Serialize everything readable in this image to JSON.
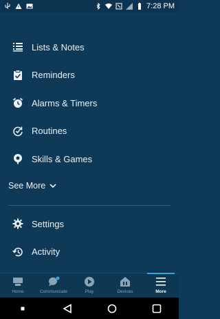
{
  "status": {
    "time": "7:28 PM"
  },
  "menu": {
    "items": [
      {
        "label": "Lists & Notes",
        "icon": "list-icon"
      },
      {
        "label": "Reminders",
        "icon": "reminder-icon"
      },
      {
        "label": "Alarms & Timers",
        "icon": "alarm-icon"
      },
      {
        "label": "Routines",
        "icon": "routine-icon"
      },
      {
        "label": "Skills & Games",
        "icon": "skills-icon"
      }
    ],
    "see_more": "See More",
    "secondary": [
      {
        "label": "Settings",
        "icon": "gear-icon"
      },
      {
        "label": "Activity",
        "icon": "history-icon"
      }
    ]
  },
  "nav": {
    "tabs": [
      {
        "label": "Home"
      },
      {
        "label": "Communicate"
      },
      {
        "label": "Play"
      },
      {
        "label": "Devices"
      },
      {
        "label": "More"
      }
    ]
  },
  "colors": {
    "background": "#0f3a57",
    "accent": "#2ea8e0"
  }
}
